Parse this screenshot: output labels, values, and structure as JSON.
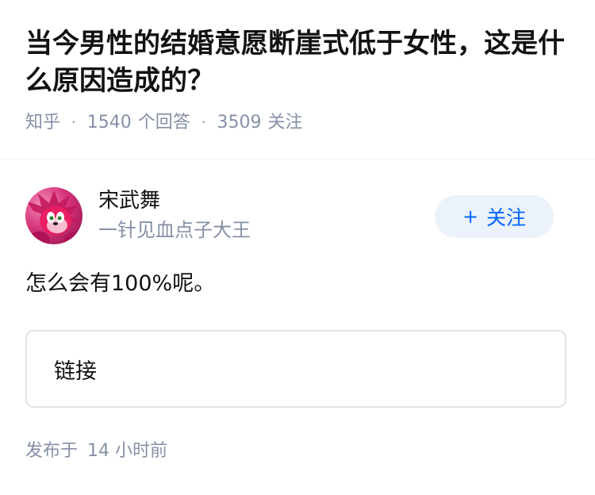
{
  "question": {
    "title": "当今男性的结婚意愿断崖式低于女性，这是什么原因造成的？",
    "source": "知乎",
    "answer_count": "1540",
    "answer_count_label": "个回答",
    "follower_count": "3509",
    "follower_count_label": "关注",
    "separator": "·"
  },
  "answer": {
    "author": {
      "name": "宋武舞",
      "bio": "一针见血点子大王",
      "avatar_icon": "avatar-pink-hedgehog"
    },
    "follow_button": {
      "icon": "+",
      "label": "关注"
    },
    "content": "怎么会有100%呢。",
    "link_card": {
      "label": "链接"
    },
    "published_label": "发布于",
    "published_time": "14 小时前"
  },
  "colors": {
    "title": "#121212",
    "meta": "#8590a6",
    "follow_bg": "#ebf2fa",
    "follow_text": "#0066ff",
    "card_border": "#e3e3e6"
  }
}
